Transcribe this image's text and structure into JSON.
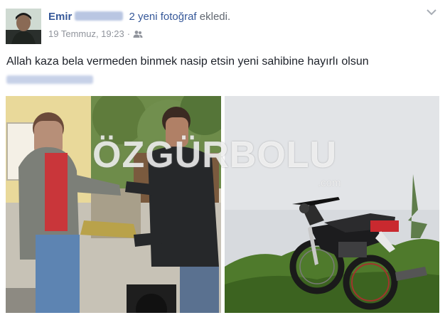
{
  "post": {
    "author_name": "Emir",
    "action_count": "2 yeni fotoğraf",
    "action_suffix": "ekledi.",
    "timestamp": "19 Temmuz, 19:23",
    "separator": "·",
    "audience_icon": "friends-icon",
    "menu_icon": "chevron-down-icon",
    "text": "Allah kaza bela vermeden binmek nasip etsin yeni sahibine hayırlı olsun"
  },
  "watermark": {
    "main": "ÖZGÜRBOLU",
    "sub": ".com"
  },
  "colors": {
    "link": "#365899",
    "meta": "#90949c",
    "text": "#1d2129"
  }
}
